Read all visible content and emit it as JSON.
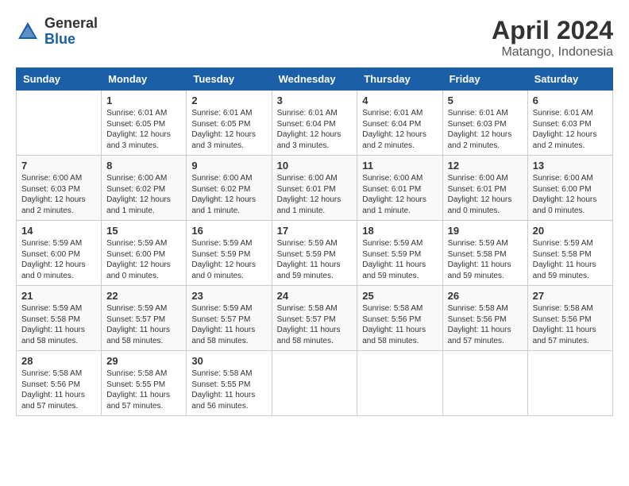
{
  "header": {
    "logo_general": "General",
    "logo_blue": "Blue",
    "month_title": "April 2024",
    "location": "Matango, Indonesia"
  },
  "columns": [
    "Sunday",
    "Monday",
    "Tuesday",
    "Wednesday",
    "Thursday",
    "Friday",
    "Saturday"
  ],
  "weeks": [
    [
      {
        "day": "",
        "info": ""
      },
      {
        "day": "1",
        "info": "Sunrise: 6:01 AM\nSunset: 6:05 PM\nDaylight: 12 hours\nand 3 minutes."
      },
      {
        "day": "2",
        "info": "Sunrise: 6:01 AM\nSunset: 6:05 PM\nDaylight: 12 hours\nand 3 minutes."
      },
      {
        "day": "3",
        "info": "Sunrise: 6:01 AM\nSunset: 6:04 PM\nDaylight: 12 hours\nand 3 minutes."
      },
      {
        "day": "4",
        "info": "Sunrise: 6:01 AM\nSunset: 6:04 PM\nDaylight: 12 hours\nand 2 minutes."
      },
      {
        "day": "5",
        "info": "Sunrise: 6:01 AM\nSunset: 6:03 PM\nDaylight: 12 hours\nand 2 minutes."
      },
      {
        "day": "6",
        "info": "Sunrise: 6:01 AM\nSunset: 6:03 PM\nDaylight: 12 hours\nand 2 minutes."
      }
    ],
    [
      {
        "day": "7",
        "info": "Sunrise: 6:00 AM\nSunset: 6:03 PM\nDaylight: 12 hours\nand 2 minutes."
      },
      {
        "day": "8",
        "info": "Sunrise: 6:00 AM\nSunset: 6:02 PM\nDaylight: 12 hours\nand 1 minute."
      },
      {
        "day": "9",
        "info": "Sunrise: 6:00 AM\nSunset: 6:02 PM\nDaylight: 12 hours\nand 1 minute."
      },
      {
        "day": "10",
        "info": "Sunrise: 6:00 AM\nSunset: 6:01 PM\nDaylight: 12 hours\nand 1 minute."
      },
      {
        "day": "11",
        "info": "Sunrise: 6:00 AM\nSunset: 6:01 PM\nDaylight: 12 hours\nand 1 minute."
      },
      {
        "day": "12",
        "info": "Sunrise: 6:00 AM\nSunset: 6:01 PM\nDaylight: 12 hours\nand 0 minutes."
      },
      {
        "day": "13",
        "info": "Sunrise: 6:00 AM\nSunset: 6:00 PM\nDaylight: 12 hours\nand 0 minutes."
      }
    ],
    [
      {
        "day": "14",
        "info": "Sunrise: 5:59 AM\nSunset: 6:00 PM\nDaylight: 12 hours\nand 0 minutes."
      },
      {
        "day": "15",
        "info": "Sunrise: 5:59 AM\nSunset: 6:00 PM\nDaylight: 12 hours\nand 0 minutes."
      },
      {
        "day": "16",
        "info": "Sunrise: 5:59 AM\nSunset: 5:59 PM\nDaylight: 12 hours\nand 0 minutes."
      },
      {
        "day": "17",
        "info": "Sunrise: 5:59 AM\nSunset: 5:59 PM\nDaylight: 11 hours\nand 59 minutes."
      },
      {
        "day": "18",
        "info": "Sunrise: 5:59 AM\nSunset: 5:59 PM\nDaylight: 11 hours\nand 59 minutes."
      },
      {
        "day": "19",
        "info": "Sunrise: 5:59 AM\nSunset: 5:58 PM\nDaylight: 11 hours\nand 59 minutes."
      },
      {
        "day": "20",
        "info": "Sunrise: 5:59 AM\nSunset: 5:58 PM\nDaylight: 11 hours\nand 59 minutes."
      }
    ],
    [
      {
        "day": "21",
        "info": "Sunrise: 5:59 AM\nSunset: 5:58 PM\nDaylight: 11 hours\nand 58 minutes."
      },
      {
        "day": "22",
        "info": "Sunrise: 5:59 AM\nSunset: 5:57 PM\nDaylight: 11 hours\nand 58 minutes."
      },
      {
        "day": "23",
        "info": "Sunrise: 5:59 AM\nSunset: 5:57 PM\nDaylight: 11 hours\nand 58 minutes."
      },
      {
        "day": "24",
        "info": "Sunrise: 5:58 AM\nSunset: 5:57 PM\nDaylight: 11 hours\nand 58 minutes."
      },
      {
        "day": "25",
        "info": "Sunrise: 5:58 AM\nSunset: 5:56 PM\nDaylight: 11 hours\nand 58 minutes."
      },
      {
        "day": "26",
        "info": "Sunrise: 5:58 AM\nSunset: 5:56 PM\nDaylight: 11 hours\nand 57 minutes."
      },
      {
        "day": "27",
        "info": "Sunrise: 5:58 AM\nSunset: 5:56 PM\nDaylight: 11 hours\nand 57 minutes."
      }
    ],
    [
      {
        "day": "28",
        "info": "Sunrise: 5:58 AM\nSunset: 5:56 PM\nDaylight: 11 hours\nand 57 minutes."
      },
      {
        "day": "29",
        "info": "Sunrise: 5:58 AM\nSunset: 5:55 PM\nDaylight: 11 hours\nand 57 minutes."
      },
      {
        "day": "30",
        "info": "Sunrise: 5:58 AM\nSunset: 5:55 PM\nDaylight: 11 hours\nand 56 minutes."
      },
      {
        "day": "",
        "info": ""
      },
      {
        "day": "",
        "info": ""
      },
      {
        "day": "",
        "info": ""
      },
      {
        "day": "",
        "info": ""
      }
    ]
  ]
}
